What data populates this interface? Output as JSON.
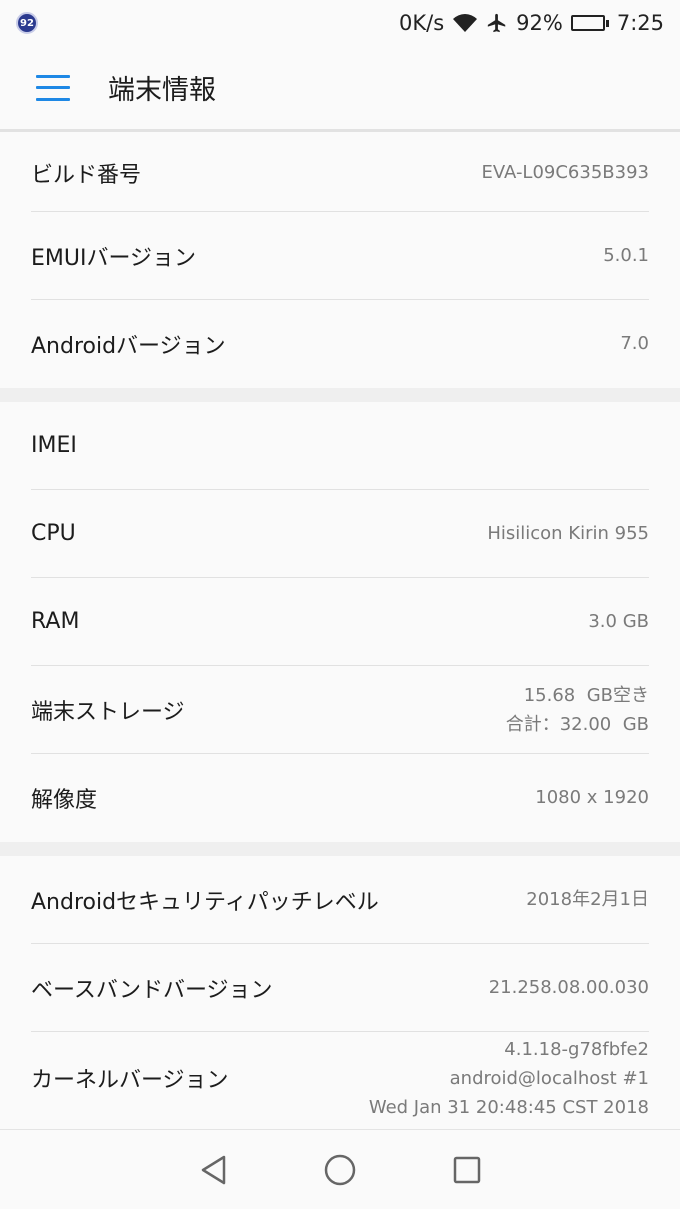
{
  "status_bar": {
    "notification_badge": "92",
    "net_speed": "0K/s",
    "battery_percent": "92%",
    "battery_level": 0.92,
    "time": "7:25",
    "icons": [
      "wifi-icon",
      "airplane-icon",
      "battery-icon"
    ]
  },
  "app_bar": {
    "title": "端末情報",
    "menu_icon": "menu-icon"
  },
  "sections": [
    {
      "rows": [
        {
          "label": "ビルド番号",
          "value": [
            "EVA-L09C635B393"
          ]
        },
        {
          "label": "EMUIバージョン",
          "value": [
            "5.0.1"
          ]
        },
        {
          "label": "Androidバージョン",
          "value": [
            "7.0"
          ]
        }
      ]
    },
    {
      "rows": [
        {
          "label": "IMEI",
          "value": [
            ""
          ]
        },
        {
          "label": "CPU",
          "value": [
            "Hisilicon Kirin 955"
          ]
        },
        {
          "label": "RAM",
          "value": [
            "3.0 GB"
          ]
        },
        {
          "label": "端末ストレージ",
          "value": [
            "15.68  GB空き",
            "合計：32.00  GB"
          ]
        },
        {
          "label": "解像度",
          "value": [
            "1080 x 1920"
          ]
        }
      ]
    },
    {
      "rows": [
        {
          "label": "Androidセキュリティパッチレベル",
          "value": [
            "2018年2月1日"
          ]
        },
        {
          "label": "ベースバンドバージョン",
          "value": [
            "21.258.08.00.030"
          ]
        },
        {
          "label": "カーネルバージョン",
          "value": [
            "4.1.18-g78fbfe2",
            "android@localhost #1",
            "Wed Jan 31 20:48:45 CST 2018"
          ]
        }
      ]
    }
  ],
  "nav_bar": {
    "buttons": [
      "back-icon",
      "home-icon",
      "recents-icon"
    ]
  },
  "colors": {
    "accent": "#1e88e5",
    "background": "#fafafa",
    "divider": "#e1e1e1",
    "secondary_text": "#7a7a7a"
  }
}
